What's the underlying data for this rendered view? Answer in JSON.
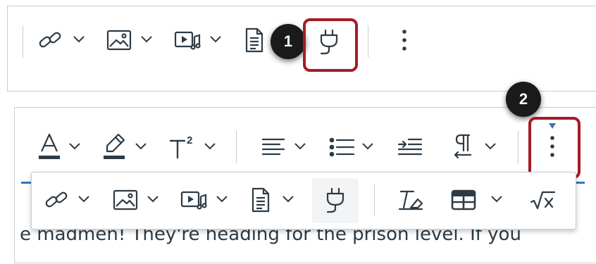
{
  "callouts": {
    "one": "1",
    "two": "2"
  },
  "editor": {
    "content_text": "e madmen!  They're heading for the prison level. If you"
  },
  "colors": {
    "highlight": "#a31c24",
    "accent": "#2b7abc",
    "icon": "#2d3b45"
  },
  "toolbar_top": {
    "items": [
      "link-icon",
      "image-icon",
      "media-icon",
      "document-icon",
      "plug-icon",
      "more-vertical-icon"
    ]
  },
  "toolbar_bottom": {
    "items": [
      "text-color-icon",
      "highlight-icon",
      "superscript-icon",
      "align-icon",
      "list-icon",
      "indent-icon",
      "paragraph-direction-icon",
      "more-vertical-icon"
    ]
  },
  "overflow_menu": {
    "items": [
      "link-icon",
      "image-icon",
      "media-icon",
      "document-icon",
      "plug-icon",
      "clear-formatting-icon",
      "table-icon",
      "equation-icon"
    ]
  }
}
